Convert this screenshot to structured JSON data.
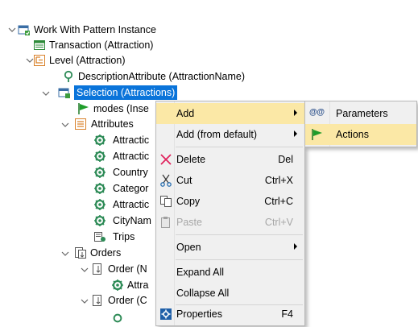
{
  "tree": {
    "root": "Work With Pattern Instance",
    "transaction": "Transaction (Attraction)",
    "level": "Level (Attraction)",
    "description_attribute": "DescriptionAttribute (AttractionName)",
    "selection": "Selection (Attractions)",
    "modes": "modes (Inse",
    "attributes": "Attributes",
    "attr_items": [
      "Attractic",
      "Attractic",
      "Country",
      "Categor",
      "Attractic",
      "CityNam"
    ],
    "trips": "Trips",
    "orders": "Orders",
    "order1": "Order (N",
    "order1_attr": "Attra",
    "order2": "Order (C"
  },
  "context_menu": {
    "add": "Add",
    "add_default": "Add (from default)",
    "delete": "Delete",
    "delete_shortcut": "Del",
    "cut": "Cut",
    "cut_shortcut": "Ctrl+X",
    "copy": "Copy",
    "copy_shortcut": "Ctrl+C",
    "paste": "Paste",
    "paste_shortcut": "Ctrl+V",
    "open": "Open",
    "expand_all": "Expand All",
    "collapse_all": "Collapse All",
    "properties": "Properties",
    "properties_shortcut": "F4"
  },
  "submenu": {
    "parameters": "Parameters",
    "parameters_glyph": "@@",
    "actions": "Actions"
  },
  "colors": {
    "selection": "#0a74da",
    "highlight": "#fbe8a6",
    "attribute_green": "#2e8b57",
    "flag_green": "#1f9d2a",
    "delete_red": "#e0245e"
  }
}
